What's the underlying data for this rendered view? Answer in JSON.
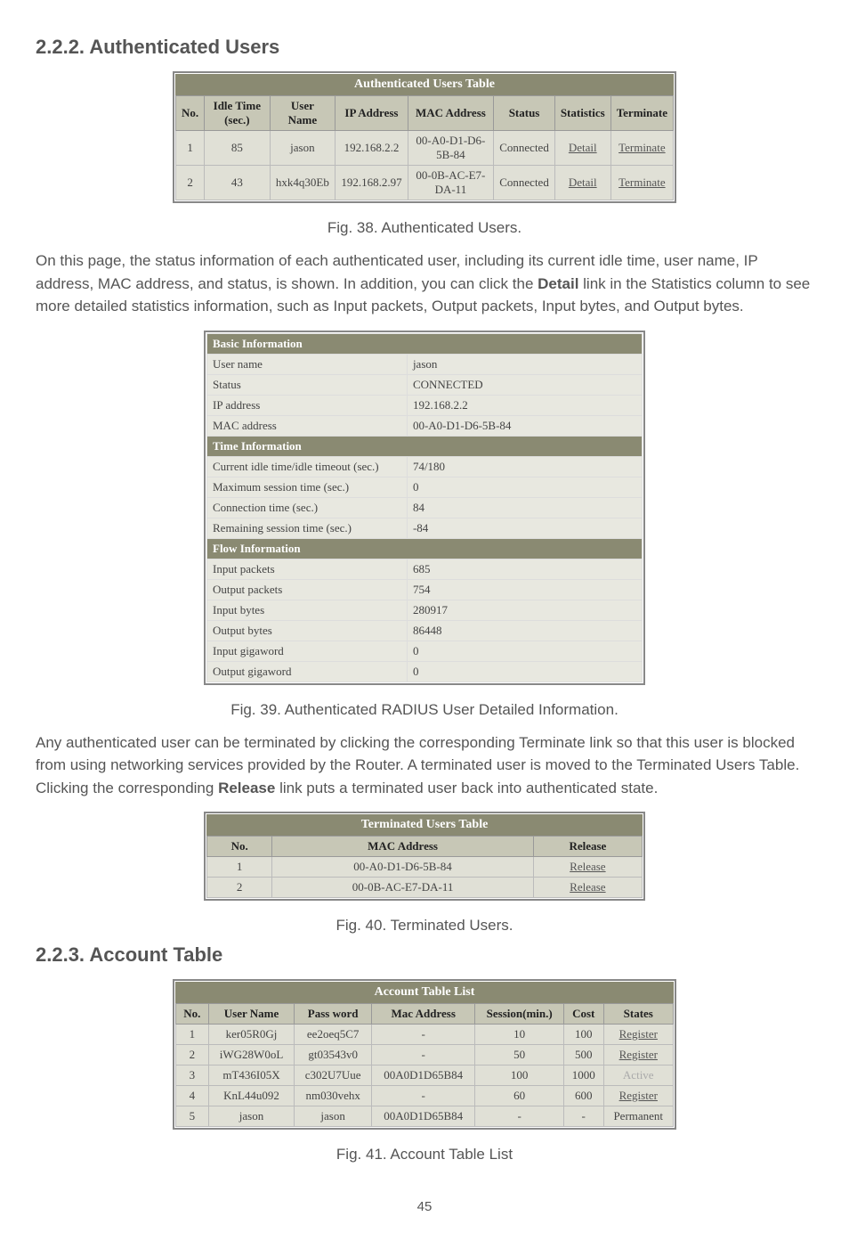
{
  "section222": {
    "heading": "2.2.2. Authenticated Users"
  },
  "authUsersTable": {
    "caption": "Authenticated Users Table",
    "headers": [
      "No.",
      "Idle Time (sec.)",
      "User Name",
      "IP Address",
      "MAC Address",
      "Status",
      "Statistics",
      "Terminate"
    ],
    "rows": [
      {
        "no": "1",
        "idle": "85",
        "user": "jason",
        "ip": "192.168.2.2",
        "mac": "00-A0-D1-D6-5B-84",
        "status": "Connected",
        "stats": "Detail",
        "term": "Terminate"
      },
      {
        "no": "2",
        "idle": "43",
        "user": "hxk4q30Eb",
        "ip": "192.168.2.97",
        "mac": "00-0B-AC-E7-DA-11",
        "status": "Connected",
        "stats": "Detail",
        "term": "Terminate"
      }
    ]
  },
  "fig38": "Fig. 38. Authenticated Users.",
  "para1_a": "On this page, the status information of each authenticated user, including its current idle time, user name, IP address, MAC address, and status, is shown. In addition, you can click the ",
  "para1_bold": "Detail",
  "para1_b": " link in the Statistics column to see more detailed statistics information, such as Input packets, Output packets, Input bytes, and Output bytes.",
  "detailTable": {
    "basic_header": "Basic Information",
    "basic": [
      {
        "k": "User name",
        "v": "jason"
      },
      {
        "k": "Status",
        "v": "CONNECTED"
      },
      {
        "k": "IP address",
        "v": "192.168.2.2"
      },
      {
        "k": "MAC address",
        "v": "00-A0-D1-D6-5B-84"
      }
    ],
    "time_header": "Time Information",
    "time": [
      {
        "k": "Current idle time/idle timeout (sec.)",
        "v": "74/180"
      },
      {
        "k": "Maximum session time (sec.)",
        "v": "0"
      },
      {
        "k": "Connection time (sec.)",
        "v": "84"
      },
      {
        "k": "Remaining session time (sec.)",
        "v": "-84"
      }
    ],
    "flow_header": "Flow Information",
    "flow": [
      {
        "k": "Input packets",
        "v": "685"
      },
      {
        "k": "Output packets",
        "v": "754"
      },
      {
        "k": "Input bytes",
        "v": "280917"
      },
      {
        "k": "Output bytes",
        "v": "86448"
      },
      {
        "k": "Input gigaword",
        "v": "0"
      },
      {
        "k": "Output gigaword",
        "v": "0"
      }
    ]
  },
  "fig39": "Fig. 39. Authenticated RADIUS User Detailed Information.",
  "para2_a": "Any authenticated user can be terminated by clicking the corresponding Terminate link so that this user is blocked from using networking services provided by the Router. A terminated user is moved to the Terminated Users Table. Clicking the corresponding ",
  "para2_bold": "Release",
  "para2_b": " link puts a terminated user back into authenticated state.",
  "termUsersTable": {
    "caption": "Terminated Users Table",
    "headers": [
      "No.",
      "MAC Address",
      "Release"
    ],
    "rows": [
      {
        "no": "1",
        "mac": "00-A0-D1-D6-5B-84",
        "rel": "Release"
      },
      {
        "no": "2",
        "mac": "00-0B-AC-E7-DA-11",
        "rel": "Release"
      }
    ]
  },
  "fig40": "Fig. 40. Terminated Users.",
  "section223": {
    "heading": "2.2.3. Account Table"
  },
  "accountTable": {
    "caption": "Account Table List",
    "headers": [
      "No.",
      "User Name",
      "Pass word",
      "Mac Address",
      "Session(min.)",
      "Cost",
      "States"
    ],
    "rows": [
      {
        "no": "1",
        "user": "ker05R0Gj",
        "pass": "ee2oeq5C7",
        "mac": "-",
        "session": "10",
        "cost": "100",
        "state": "Register",
        "link": true
      },
      {
        "no": "2",
        "user": "iWG28W0oL",
        "pass": "gt03543v0",
        "mac": "-",
        "session": "50",
        "cost": "500",
        "state": "Register",
        "link": true
      },
      {
        "no": "3",
        "user": "mT436I05X",
        "pass": "c302U7Uue",
        "mac": "00A0D1D65B84",
        "session": "100",
        "cost": "1000",
        "state": "Active",
        "link": false
      },
      {
        "no": "4",
        "user": "KnL44u092",
        "pass": "nm030vehx",
        "mac": "-",
        "session": "60",
        "cost": "600",
        "state": "Register",
        "link": true
      },
      {
        "no": "5",
        "user": "jason",
        "pass": "jason",
        "mac": "00A0D1D65B84",
        "session": "-",
        "cost": "-",
        "state": "Permanent",
        "link": false
      }
    ]
  },
  "fig41": "Fig. 41. Account Table List",
  "page_num": "45"
}
